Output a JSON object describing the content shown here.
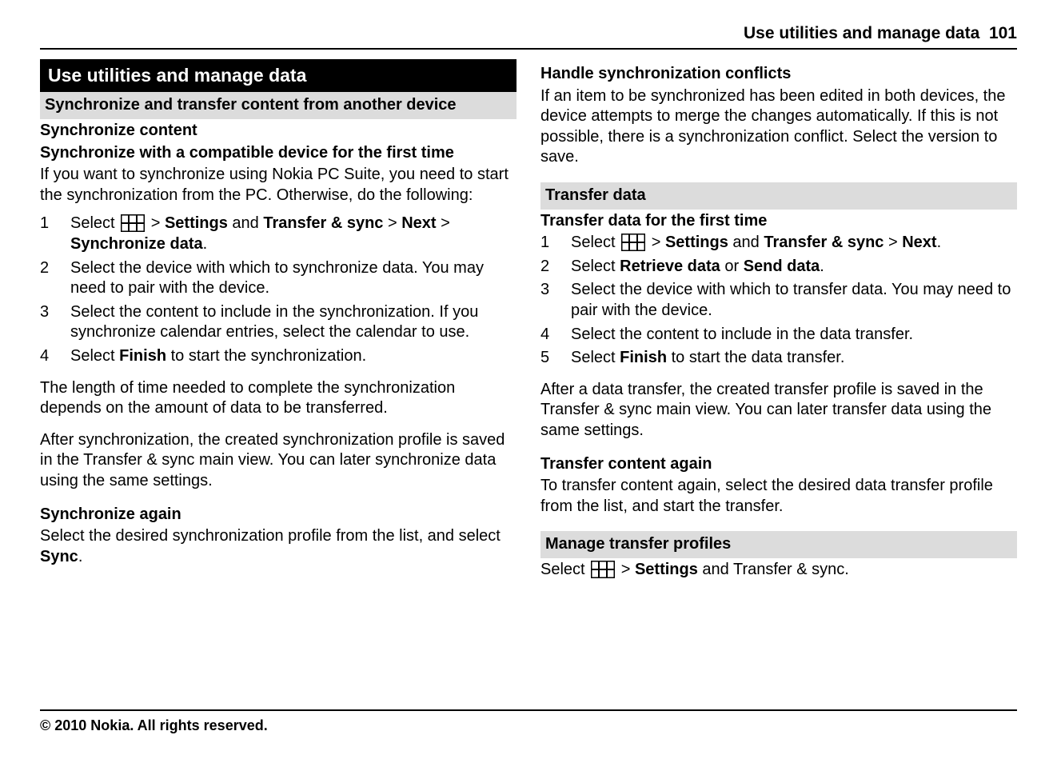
{
  "header": {
    "title": "Use utilities and manage data",
    "page": "101"
  },
  "left": {
    "chapter": "Use utilities and manage data",
    "section1": "Synchronize and transfer content from another device",
    "section1_sub": "Synchronize content",
    "h1": "Synchronize with a compatible device for the first time",
    "p1": "If you want to synchronize using Nokia PC Suite, you need to start the synchronization from the PC. Otherwise, do the following:",
    "steps1": {
      "s1a": "Select ",
      "s1b": " > ",
      "s1_settings": "Settings",
      "s1c": " and ",
      "s1_ts": "Transfer & sync",
      "s1d": "  > ",
      "s1_next": "Next",
      "s1e": "  > ",
      "s1_sync": "Synchronize data",
      "s1f": ".",
      "s2": "Select the device with which to synchronize data. You may need to pair with the device.",
      "s3": "Select the content to include in the synchronization. If you synchronize calendar entries, select the calendar to use.",
      "s4a": "Select ",
      "s4_finish": "Finish",
      "s4b": " to start the synchronization."
    },
    "p2": "The length of time needed to complete the synchronization depends on the amount of data to be transferred.",
    "p3": "After synchronization, the created synchronization profile is saved in the Transfer & sync main view. You can later synchronize data using the same settings.",
    "h2": "Synchronize again",
    "p4a": "Select the desired synchronization profile from the list, and select ",
    "p4_sync": "Sync",
    "p4b": "."
  },
  "right": {
    "h1": "Handle synchronization conflicts",
    "p1": "If an item to be synchronized has been edited in both devices, the device attempts to merge the changes automatically. If this is not possible, there is a synchronization conflict. Select the version to save.",
    "section2": "Transfer data",
    "h2": "Transfer data for the first time",
    "steps2": {
      "s1a": "Select ",
      "s1b": " > ",
      "s1_settings": "Settings",
      "s1c": " and ",
      "s1_ts": "Transfer & sync",
      "s1d": "  > ",
      "s1_next": "Next",
      "s1e": ".",
      "s2a": "Select ",
      "s2_retrieve": "Retrieve data",
      "s2b": " or ",
      "s2_send": "Send data",
      "s2c": ".",
      "s3": "Select the device with which to transfer data. You may need to pair with the device.",
      "s4": "Select the content to include in the data transfer.",
      "s5a": "Select ",
      "s5_finish": "Finish",
      "s5b": " to start the data transfer."
    },
    "p2": "After a data transfer, the created transfer profile is saved in the Transfer & sync main view. You can later transfer data using the same settings.",
    "h3": "Transfer content again",
    "p3": "To transfer content again, select the desired data transfer profile from the list, and start the transfer.",
    "section3": "Manage transfer profiles",
    "p4a": "Select ",
    "p4b": " > ",
    "p4_settings": "Settings",
    "p4c": " and Transfer & sync."
  },
  "footer": "© 2010 Nokia. All rights reserved."
}
